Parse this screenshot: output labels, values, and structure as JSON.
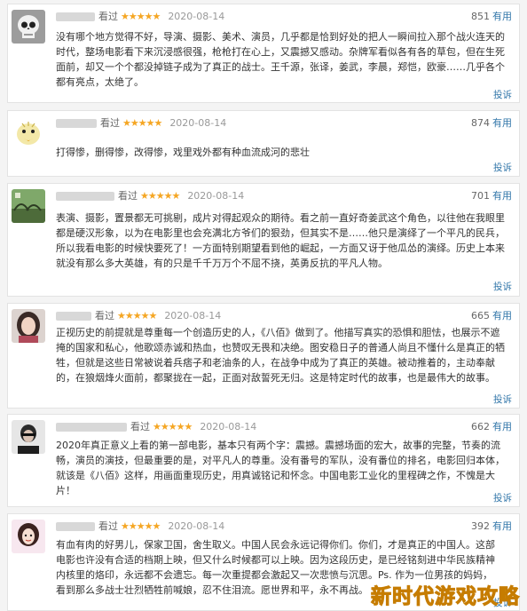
{
  "reviews": [
    {
      "seen": "看过",
      "stars": "★★★★★",
      "date": "2020-08-14",
      "votes": "851",
      "useful": "有用",
      "text": "没有哪个地方觉得不好，导演、摄影、美术、演员，几乎都是恰到好处的把人一瞬间拉入那个战火连天的时代，整场电影看下来沉浸感很强，枪枪打在心上，又震撼又感动。杂牌军看似各有各的草包，但在生死面前，却又一个个都没掉链子成为了真正的战士。王千源，张译，姜武，李晨，郑恺，欧豪……几乎各个都有亮点，太绝了。",
      "report": "投诉"
    },
    {
      "seen": "看过",
      "stars": "★★★★★",
      "date": "2020-08-14",
      "votes": "874",
      "useful": "有用",
      "text": "打得惨，删得惨，改得惨，戏里戏外都有种血流成河的悲壮",
      "report": "投诉"
    },
    {
      "seen": "看过",
      "stars": "★★★★★",
      "date": "2020-08-14",
      "votes": "701",
      "useful": "有用",
      "text": "表演、摄影，置景都无可挑剔，成片对得起观众的期待。看之前一直好奇姜武这个角色，以往他在我眼里都是硬汉形象，以为在电影里也会充满北方爷们的狠劲，但其实不是……他只是演绎了一个平凡的民兵，所以我看电影的时候快要死了！一方面特别期望看到他的崛起，一方面又讶于他瓜怂的演绎。历史上本来就没有那么多大英雄，有的只是千千万万个不屈不挠，英勇反抗的平凡人物。",
      "report": "投诉"
    },
    {
      "seen": "看过",
      "stars": "★★★★★",
      "date": "2020-08-14",
      "votes": "665",
      "useful": "有用",
      "text": "正视历史的前提就是尊重每一个创造历史的人，《八佰》做到了。他描写真实的恐惧和胆怯，也展示不遮掩的国家和私心，他歌颂赤诚和热血，也赞叹无畏和决绝。图安稳日子的普通人尚且不懂什么是真正的牺牲，但就是这些日常被说着兵痞子和老油条的人，在战争中成为了真正的英雄。被动推着的，主动奉献的，在狼烟烽火面前，都聚拢在一起，正面对敌誓死无归。这是特定时代的故事，也是最伟大的故事。",
      "report": "投诉"
    },
    {
      "seen": "看过",
      "stars": "★★★★★",
      "date": "2020-08-14",
      "votes": "662",
      "useful": "有用",
      "text": "2020年真正意义上看的第一部电影，基本只有两个字：震撼。震撼场面的宏大，故事的完整，节奏的流畅，演员的演技，但最重要的是，对平凡人的尊重。没有番号的军队，没有番位的排名，电影回归本体，就该是《八佰》这样，用画面重现历史，用真诚铭记和怀念。中国电影工业化的里程碑之作，不愧是大片！",
      "report": "投诉"
    },
    {
      "seen": "看过",
      "stars": "★★★★★",
      "date": "2020-08-14",
      "votes": "392",
      "useful": "有用",
      "text": "有血有肉的好男儿，保家卫国，舍生取义。中国人民会永远记得你们。你们，才是真正的中国人。这部电影也许没有合适的档期上映，但又什么时候都可以上映。因为这段历史，是已经铭刻进中华民族精神内核里的烙印，永远都不会遗忘。每一次重提都会激起又一次悲愤与沉思。Ps. 作为一位男孩的妈妈，看到那么多战士壮烈牺牲前喊娘，忍不住泪流。愿世界和平，永不再战。",
      "report": "投诉"
    }
  ],
  "watermark": "新时代游戏攻略",
  "colors": {
    "link": "#3377aa",
    "star": "#f5a623",
    "watermark": "#f2b705"
  }
}
